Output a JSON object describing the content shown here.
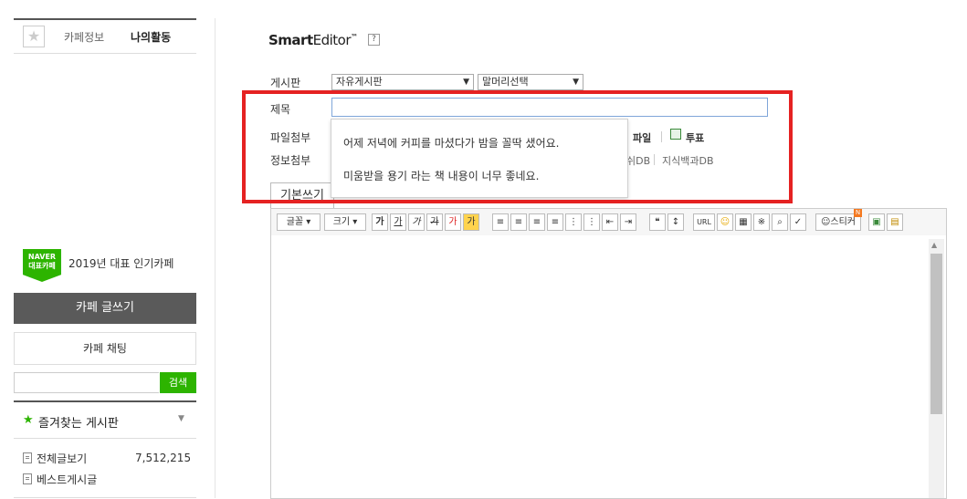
{
  "sidebar": {
    "star": "★",
    "tabs": [
      {
        "label": "카페정보"
      },
      {
        "label": "나의활동"
      }
    ],
    "naver_badge": {
      "line1": "NAVER",
      "line2": "대표카페"
    },
    "naver_label": "2019년 대표 인기카페",
    "write_button": "카페 글쓰기",
    "chat_button": "카페 채팅",
    "search": {
      "placeholder": "",
      "button": "검색"
    },
    "favorites": {
      "star": "★",
      "label": "즐겨찾는 게시판",
      "caret": "▼"
    },
    "items": [
      {
        "label": "전체글보기",
        "count": "7,512,215"
      },
      {
        "label": "베스트게시글",
        "count": ""
      }
    ]
  },
  "editor": {
    "logo_bold": "Smart",
    "logo_light": "Editor",
    "logo_tm": "™",
    "help": "?",
    "board_label": "게시판",
    "board_select": "자유게시판",
    "header_select": "말머리선택",
    "title_label": "제목",
    "title_value": "",
    "file_label": "파일첨부",
    "info_label": "정보첨부",
    "attach": {
      "file": "파일",
      "vote": "투표"
    },
    "info_items": [
      "쉬DB",
      "지식백과DB"
    ],
    "tab_basic": "기본쓰기",
    "toolbar": {
      "font": "글꼴",
      "size": "크기",
      "bold": "가",
      "underline": "가",
      "italic": "가",
      "strike": "가",
      "color": "가",
      "bg": "가",
      "quote": "❝",
      "url": "URL",
      "sticker": "스티커",
      "new_badge": "N"
    }
  },
  "suggestions": [
    {
      "text": "어제 저녁에 커피를 마셨다가 밤을 꼴딱 샜어요."
    },
    {
      "text": "미움받을 용기 라는 책 내용이 너무 좋네요."
    }
  ],
  "colors": {
    "accent_green": "#2db400",
    "highlight_red": "#e52222",
    "dark_button": "#5a5a5a"
  }
}
